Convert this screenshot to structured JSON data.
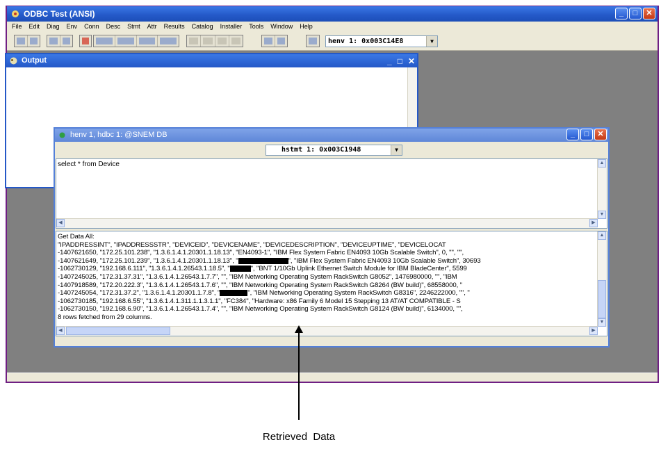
{
  "app": {
    "title": "ODBC Test (ANSI)",
    "menu": [
      "File",
      "Edit",
      "Diag",
      "Env",
      "Conn",
      "Desc",
      "Stmt",
      "Attr",
      "Results",
      "Catalog",
      "Installer",
      "Tools",
      "Window",
      "Help"
    ],
    "henv_combo": "henv 1: 0x003C14E8"
  },
  "output_window": {
    "title": "Output"
  },
  "child_window": {
    "title": "henv 1, hdbc 1: @SNEM DB",
    "hstmt_combo": "hstmt 1: 0x003C1948",
    "sql": "select * from Device"
  },
  "results": {
    "header": "Get Data All:",
    "columns": "\"IPADDRESSINT\", \"IPADDRESSSTR\", \"DEVICEID\", \"DEVICENAME\", \"DEVICEDESCRIPTION\", \"DEVICEUPTIME\", \"DEVICELOCAT",
    "rows": [
      {
        "pre": "-1407621650, \"172.25.101.238\", \"1.3.6.1.4.1.20301.1.18.13\", \"EN4093-1\", \"IBM Flex System Fabric EN4093 10Gb Scalable Switch\", 0, \"\", \"\",",
        "post": ""
      },
      {
        "pre": "-1407621649, \"172.25.101.239\", \"1.3.6.1.4.1.20301.1.18.13\", \"",
        "post": "\", \"IBM Flex System Fabric EN4093 10Gb Scalable Switch\", 30693"
      },
      {
        "pre": "-1062730129, \"192.168.6.111\", \"1.3.6.1.4.1.26543.1.18.5\", \"",
        "post": "\", \"BNT 1/10Gb Uplink Ethernet Switch Module for IBM BladeCenter\", 5599"
      },
      {
        "pre": "-1407245025, \"172.31.37.31\", \"1.3.6.1.4.1.26543.1.7.7\", \"\", \"IBM Networking Operating System RackSwitch G8052\", 1476980000, \"\", \"IBM",
        "post": ""
      },
      {
        "pre": "-1407918589, \"172.20.222.3\", \"1.3.6.1.4.1.26543.1.7.6\", \"\", \"IBM Networking Operating System RackSwitch G8264 (BW build)\", 68558000, \"",
        "post": ""
      },
      {
        "pre": "-1407245054, \"172.31.37.2\", \"1.3.6.1.4.1.20301.1.7.8\", \"",
        "post": "\", \"IBM Networking Operating System RackSwitch G8316\", 2246222000, \"\", \""
      },
      {
        "pre": "-1062730185, \"192.168.6.55\", \"1.3.6.1.4.1.311.1.1.3.1.1\", \"FC384\", \"Hardware: x86 Family 6 Model 15 Stepping 13 AT/AT COMPATIBLE - S",
        "post": ""
      },
      {
        "pre": "-1062730150, \"192.168.6.90\", \"1.3.6.1.4.1.26543.1.7.4\", \"\", \"IBM Networking Operating System RackSwitch G8124 (BW build)\", 6134000, \"\",",
        "post": ""
      }
    ],
    "footer": "8 rows fetched from 29 columns."
  },
  "annotation": {
    "caption": "Retrieved  Data"
  }
}
